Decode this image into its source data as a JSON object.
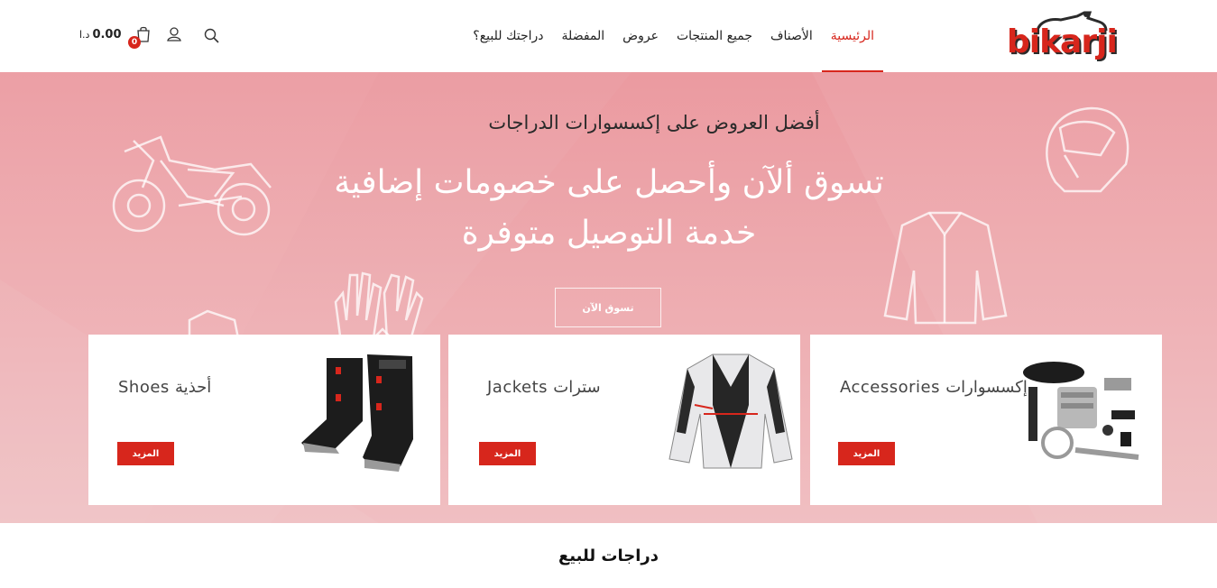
{
  "brand": {
    "logo_text": "bikarji",
    "accent": "#d7261c"
  },
  "nav": {
    "items": [
      {
        "label": "الرئيسية",
        "active": true
      },
      {
        "label": "الأصناف",
        "active": false
      },
      {
        "label": "جميع المنتجات",
        "active": false
      },
      {
        "label": "عروض",
        "active": false
      },
      {
        "label": "المفضلة",
        "active": false
      },
      {
        "label": "دراجتك للبيع؟",
        "active": false
      }
    ]
  },
  "tools": {
    "cart_total": "0.00",
    "currency": "د.ا",
    "cart_count": "0",
    "icons": [
      "search-icon",
      "user-icon",
      "cart-icon"
    ]
  },
  "hero": {
    "subtitle": "أفضل العروض على إكسسوارات الدراجات",
    "title_line1": "تسوق ألآن وأحصل على خصومات إضافية",
    "title_line2": "خدمة التوصيل متوفرة",
    "button_label": "تسوق الآن"
  },
  "cards": [
    {
      "title": "Shoes أحذية",
      "button": "المزيد",
      "image": "boots"
    },
    {
      "title": "Jackets سترات",
      "button": "المزيد",
      "image": "jacket"
    },
    {
      "title": "Accessories إكسسوارات",
      "button": "المزيد",
      "image": "engine-kit"
    }
  ],
  "section": {
    "title": "دراجات للبيع"
  }
}
